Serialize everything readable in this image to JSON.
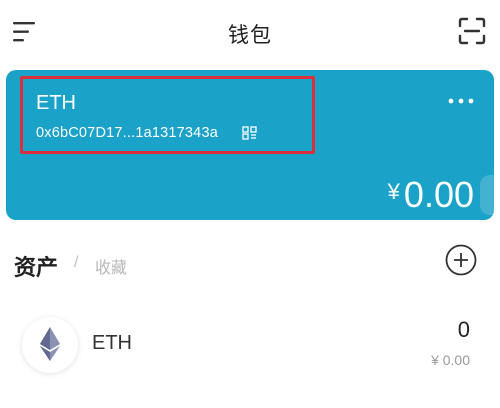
{
  "header": {
    "title": "钱包",
    "menu_icon": "menu-icon",
    "scan_icon": "scan-icon"
  },
  "wallet_card": {
    "name": "ETH",
    "address": "0x6bC07D17...1a1317343a",
    "more": "···",
    "currency_symbol": "¥",
    "balance": "0.00",
    "background_color": "#1aa2c9",
    "highlight_color": "#d9303a"
  },
  "tabs": {
    "assets": "资产",
    "separator": "/",
    "favorites": "收藏"
  },
  "assets": [
    {
      "icon": "ethereum-icon",
      "name": "ETH",
      "quantity": "0",
      "value": "¥ 0.00"
    }
  ]
}
